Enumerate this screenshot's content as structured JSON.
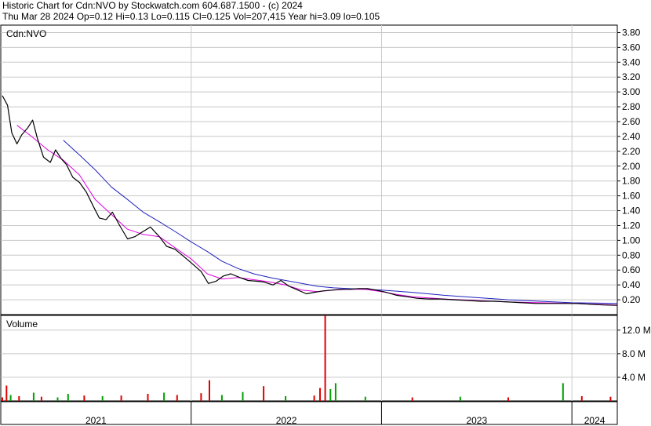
{
  "header": {
    "line1": "Historic Chart for Cdn:NVO by Stockwatch.com 604.687.1500 - (c) 2024",
    "line2": "Thu Mar 28 2024   Op=0.12  Hi=0.13  Lo=0.115  Cl=0.125  Vol=207,415   Year hi=3.09  lo=0.105"
  },
  "colors": {
    "price": "#000000",
    "ma_short": "#e000e0",
    "ma_long": "#2020c0",
    "volume_up": "#00a000",
    "volume_down": "#e00000",
    "grid": "#c8c8c8"
  },
  "chart_data": {
    "type": "line",
    "title": "Cdn:NVO",
    "x_labels": [
      "2021",
      "2022",
      "2023",
      "2024"
    ],
    "x_range": [
      "2021-01-01",
      "2024-03-28"
    ],
    "price_panel": {
      "ylim": [
        0,
        3.9
      ],
      "y_ticks": [
        "3.80",
        "3.60",
        "3.40",
        "3.20",
        "3.00",
        "2.80",
        "2.60",
        "2.40",
        "2.20",
        "2.00",
        "1.80",
        "1.60",
        "1.40",
        "1.20",
        "1.00",
        "0.80",
        "0.60",
        "0.40",
        "0.20"
      ],
      "series": [
        {
          "key": "close",
          "points": [
            [
              "2021-01-04",
              2.95
            ],
            [
              "2021-01-14",
              2.82
            ],
            [
              "2021-01-22",
              2.45
            ],
            [
              "2021-02-01",
              2.3
            ],
            [
              "2021-02-10",
              2.42
            ],
            [
              "2021-02-22",
              2.52
            ],
            [
              "2021-03-03",
              2.62
            ],
            [
              "2021-03-12",
              2.38
            ],
            [
              "2021-03-24",
              2.12
            ],
            [
              "2021-04-06",
              2.05
            ],
            [
              "2021-04-16",
              2.22
            ],
            [
              "2021-04-27",
              2.1
            ],
            [
              "2021-05-07",
              2.02
            ],
            [
              "2021-05-19",
              1.85
            ],
            [
              "2021-06-01",
              1.78
            ],
            [
              "2021-06-14",
              1.65
            ],
            [
              "2021-06-28",
              1.45
            ],
            [
              "2021-07-09",
              1.3
            ],
            [
              "2021-07-22",
              1.28
            ],
            [
              "2021-08-03",
              1.38
            ],
            [
              "2021-08-17",
              1.2
            ],
            [
              "2021-09-01",
              1.02
            ],
            [
              "2021-09-15",
              1.05
            ],
            [
              "2021-10-01",
              1.12
            ],
            [
              "2021-10-15",
              1.18
            ],
            [
              "2021-11-01",
              1.05
            ],
            [
              "2021-11-15",
              0.92
            ],
            [
              "2021-12-01",
              0.88
            ],
            [
              "2021-12-15",
              0.8
            ],
            [
              "2022-01-04",
              0.68
            ],
            [
              "2022-01-20",
              0.58
            ],
            [
              "2022-02-03",
              0.42
            ],
            [
              "2022-02-18",
              0.45
            ],
            [
              "2022-03-04",
              0.52
            ],
            [
              "2022-03-18",
              0.55
            ],
            [
              "2022-04-04",
              0.5
            ],
            [
              "2022-04-20",
              0.46
            ],
            [
              "2022-05-06",
              0.45
            ],
            [
              "2022-05-20",
              0.44
            ],
            [
              "2022-06-07",
              0.4
            ],
            [
              "2022-06-22",
              0.46
            ],
            [
              "2022-07-08",
              0.38
            ],
            [
              "2022-07-25",
              0.33
            ],
            [
              "2022-08-10",
              0.28
            ],
            [
              "2022-08-25",
              0.3
            ],
            [
              "2022-09-12",
              0.32
            ],
            [
              "2022-09-28",
              0.33
            ],
            [
              "2022-10-14",
              0.34
            ],
            [
              "2022-11-01",
              0.34
            ],
            [
              "2022-11-18",
              0.35
            ],
            [
              "2022-12-05",
              0.35
            ],
            [
              "2022-12-22",
              0.33
            ],
            [
              "2023-01-10",
              0.3
            ],
            [
              "2023-01-30",
              0.26
            ],
            [
              "2023-02-20",
              0.24
            ],
            [
              "2023-03-10",
              0.22
            ],
            [
              "2023-04-01",
              0.21
            ],
            [
              "2023-04-25",
              0.21
            ],
            [
              "2023-05-20",
              0.2
            ],
            [
              "2023-06-15",
              0.19
            ],
            [
              "2023-07-10",
              0.18
            ],
            [
              "2023-08-05",
              0.18
            ],
            [
              "2023-09-01",
              0.17
            ],
            [
              "2023-09-28",
              0.16
            ],
            [
              "2023-10-25",
              0.15
            ],
            [
              "2023-11-20",
              0.15
            ],
            [
              "2023-12-15",
              0.15
            ],
            [
              "2024-01-10",
              0.15
            ],
            [
              "2024-02-05",
              0.14
            ],
            [
              "2024-03-01",
              0.13
            ],
            [
              "2024-03-28",
              0.125
            ]
          ]
        },
        {
          "key": "ma_short",
          "points": [
            [
              "2021-02-01",
              2.55
            ],
            [
              "2021-03-01",
              2.4
            ],
            [
              "2021-04-01",
              2.22
            ],
            [
              "2021-05-01",
              2.08
            ],
            [
              "2021-06-01",
              1.88
            ],
            [
              "2021-07-01",
              1.55
            ],
            [
              "2021-08-01",
              1.35
            ],
            [
              "2021-09-01",
              1.15
            ],
            [
              "2021-10-01",
              1.08
            ],
            [
              "2021-11-01",
              1.05
            ],
            [
              "2021-12-01",
              0.9
            ],
            [
              "2022-01-01",
              0.75
            ],
            [
              "2022-02-01",
              0.55
            ],
            [
              "2022-03-01",
              0.48
            ],
            [
              "2022-04-01",
              0.5
            ],
            [
              "2022-05-01",
              0.47
            ],
            [
              "2022-06-01",
              0.44
            ],
            [
              "2022-07-01",
              0.4
            ],
            [
              "2022-08-01",
              0.33
            ],
            [
              "2022-09-01",
              0.31
            ],
            [
              "2022-10-01",
              0.33
            ],
            [
              "2022-11-01",
              0.34
            ],
            [
              "2022-12-01",
              0.34
            ],
            [
              "2023-01-01",
              0.31
            ],
            [
              "2023-02-01",
              0.27
            ],
            [
              "2023-03-01",
              0.24
            ],
            [
              "2023-05-01",
              0.21
            ],
            [
              "2023-07-01",
              0.19
            ],
            [
              "2023-09-01",
              0.17
            ],
            [
              "2023-11-01",
              0.16
            ],
            [
              "2024-01-01",
              0.15
            ],
            [
              "2024-03-28",
              0.13
            ]
          ]
        },
        {
          "key": "ma_long",
          "points": [
            [
              "2021-05-01",
              2.35
            ],
            [
              "2021-06-01",
              2.15
            ],
            [
              "2021-07-01",
              1.95
            ],
            [
              "2021-08-01",
              1.72
            ],
            [
              "2021-09-01",
              1.55
            ],
            [
              "2021-10-01",
              1.38
            ],
            [
              "2021-11-01",
              1.25
            ],
            [
              "2021-12-01",
              1.12
            ],
            [
              "2022-01-01",
              0.98
            ],
            [
              "2022-02-01",
              0.85
            ],
            [
              "2022-03-01",
              0.72
            ],
            [
              "2022-04-01",
              0.62
            ],
            [
              "2022-05-01",
              0.55
            ],
            [
              "2022-06-01",
              0.5
            ],
            [
              "2022-07-01",
              0.46
            ],
            [
              "2022-08-01",
              0.42
            ],
            [
              "2022-09-01",
              0.38
            ],
            [
              "2022-10-01",
              0.36
            ],
            [
              "2022-11-01",
              0.35
            ],
            [
              "2022-12-01",
              0.34
            ],
            [
              "2023-01-01",
              0.33
            ],
            [
              "2023-03-01",
              0.3
            ],
            [
              "2023-05-01",
              0.26
            ],
            [
              "2023-07-01",
              0.23
            ],
            [
              "2023-09-01",
              0.2
            ],
            [
              "2023-11-01",
              0.18
            ],
            [
              "2024-01-01",
              0.16
            ],
            [
              "2024-03-28",
              0.15
            ]
          ]
        }
      ]
    },
    "volume_panel": {
      "title": "Volume",
      "ylim": [
        0,
        14.5
      ],
      "y_ticks": [
        "12.0 M",
        "8.0 M",
        "4.0 M"
      ],
      "bars": [
        [
          "2021-01-04",
          0.6,
          "down"
        ],
        [
          "2021-01-12",
          2.6,
          "down"
        ],
        [
          "2021-01-20",
          1.0,
          "up"
        ],
        [
          "2021-02-05",
          0.8,
          "down"
        ],
        [
          "2021-03-05",
          1.4,
          "up"
        ],
        [
          "2021-03-20",
          0.7,
          "down"
        ],
        [
          "2021-04-20",
          0.6,
          "up"
        ],
        [
          "2021-05-10",
          1.2,
          "up"
        ],
        [
          "2021-06-10",
          0.9,
          "down"
        ],
        [
          "2021-07-15",
          0.8,
          "up"
        ],
        [
          "2021-08-20",
          0.9,
          "down"
        ],
        [
          "2021-10-10",
          1.2,
          "down"
        ],
        [
          "2021-11-10",
          1.4,
          "up"
        ],
        [
          "2021-12-05",
          1.0,
          "down"
        ],
        [
          "2022-01-20",
          1.3,
          "down"
        ],
        [
          "2022-02-05",
          3.5,
          "down"
        ],
        [
          "2022-03-01",
          1.0,
          "up"
        ],
        [
          "2022-04-10",
          1.5,
          "up"
        ],
        [
          "2022-05-20",
          2.5,
          "down"
        ],
        [
          "2022-07-01",
          0.8,
          "up"
        ],
        [
          "2022-08-25",
          0.9,
          "down"
        ],
        [
          "2022-09-05",
          2.2,
          "down"
        ],
        [
          "2022-09-15",
          14.5,
          "down"
        ],
        [
          "2022-09-25",
          2.0,
          "up"
        ],
        [
          "2022-10-05",
          3.0,
          "up"
        ],
        [
          "2022-12-01",
          0.7,
          "up"
        ],
        [
          "2023-03-01",
          0.6,
          "down"
        ],
        [
          "2023-06-01",
          0.7,
          "up"
        ],
        [
          "2023-09-01",
          0.6,
          "down"
        ],
        [
          "2023-12-15",
          3.0,
          "up"
        ],
        [
          "2024-01-20",
          0.8,
          "down"
        ],
        [
          "2024-03-15",
          0.7,
          "down"
        ]
      ]
    }
  }
}
